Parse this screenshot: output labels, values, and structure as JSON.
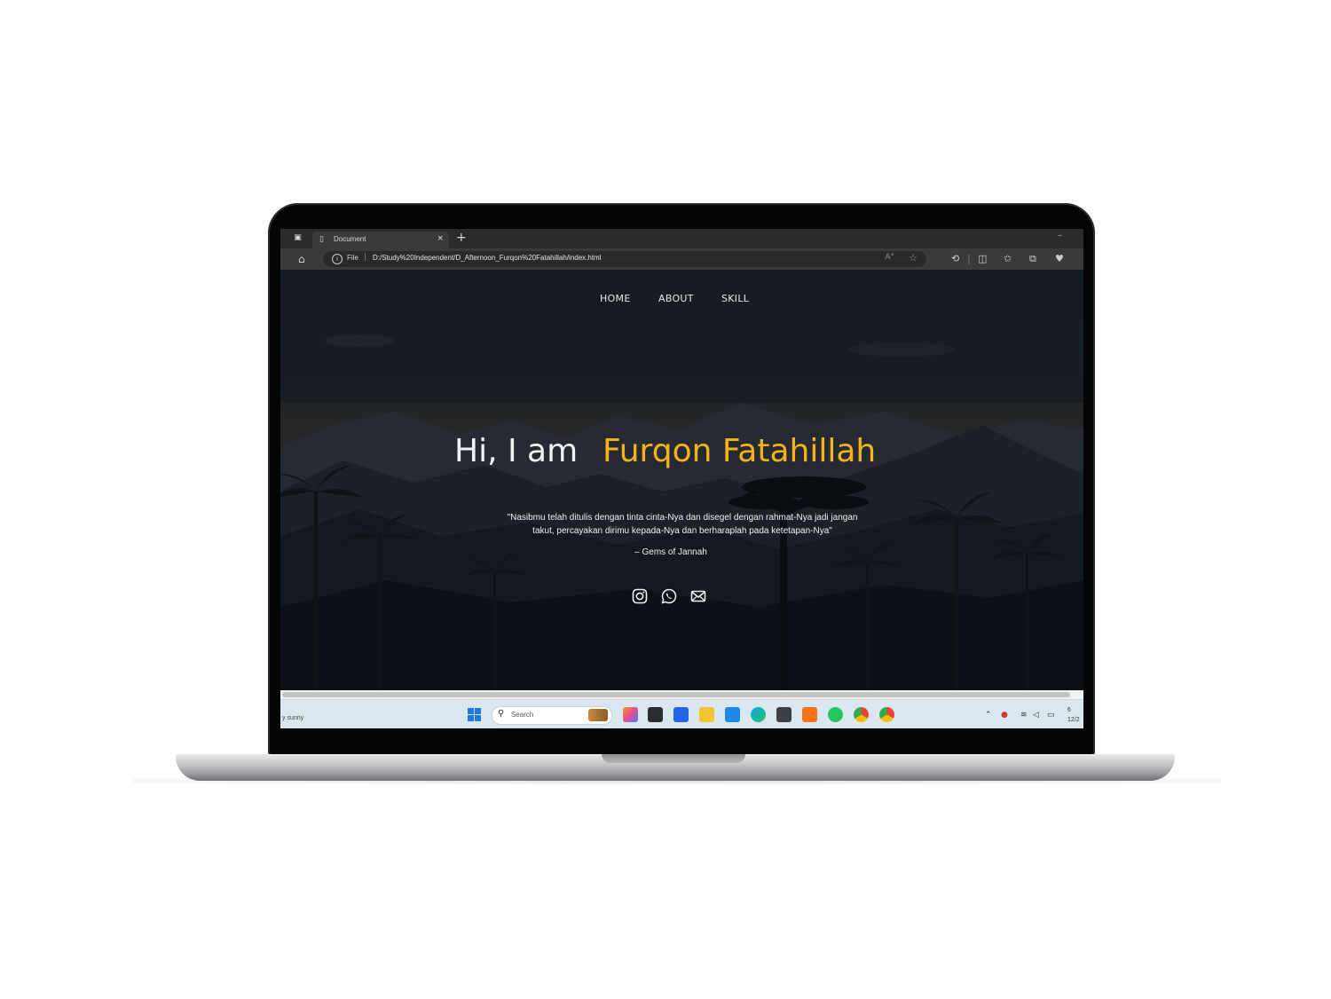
{
  "browser": {
    "tab_title": "Document",
    "close_glyph": "×",
    "new_tab_glyph": "+",
    "minimize_glyph": "–",
    "url_scheme": "File",
    "url": "D:/Study%20Independent/D_Afternoon_Furqon%20Fatahillah/index.html",
    "toolbar_icons": [
      "read-aloud-icon",
      "favorite-star-icon",
      "extensions-icon",
      "split-screen-icon",
      "favorites-icon",
      "collections-icon",
      "copilot-icon"
    ]
  },
  "site": {
    "nav": [
      "HOME",
      "ABOUT",
      "SKILL"
    ],
    "greeting": "Hi, I am",
    "name": "Furqon Fatahillah",
    "quote_line1": "\"Nasibmu telah ditulis dengan tinta cinta-Nya dan disegel dengan rahmat-Nya jadi jangan",
    "quote_line2": "takut, percayakan dirimu kepada-Nya dan berharaplah pada ketetapan-Nya\"",
    "quote_source": "– Gems of Jannah",
    "social": [
      "instagram-icon",
      "whatsapp-icon",
      "mail-icon"
    ],
    "accent_color": "#f5b21b"
  },
  "taskbar": {
    "weather": "y sunny",
    "search_placeholder": "Search",
    "clock_time": "6",
    "clock_date": "12/2",
    "apps": [
      "start-icon",
      "copilot-icon",
      "task-view-icon",
      "store-icon",
      "file-explorer-icon",
      "vscode-icon",
      "edge-icon",
      "app-icon",
      "xampp-icon",
      "whatsapp-icon",
      "chrome-icon",
      "chrome-profile-icon"
    ]
  }
}
